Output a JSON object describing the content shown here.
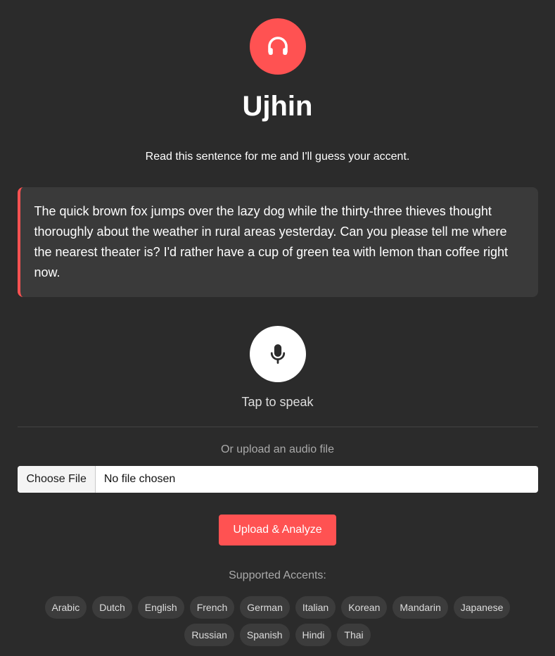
{
  "header": {
    "logo_icon": "headphones-icon",
    "title": "Ujhin",
    "subtitle": "Read this sentence for me and I'll guess your accent."
  },
  "sentence": "The quick brown fox jumps over the lazy dog while the thirty-three thieves thought thoroughly about the weather in rural areas yesterday. Can you please tell me where the nearest theater is? I'd rather have a cup of green tea with lemon than coffee right now.",
  "record": {
    "icon": "microphone-icon",
    "label": "Tap to speak"
  },
  "upload": {
    "label": "Or upload an audio file",
    "choose_file": "Choose File",
    "no_file": "No file chosen",
    "button": "Upload & Analyze"
  },
  "accents": {
    "label": "Supported Accents:",
    "items": [
      "Arabic",
      "Dutch",
      "English",
      "French",
      "German",
      "Italian",
      "Korean",
      "Mandarin",
      "Japanese",
      "Russian",
      "Spanish",
      "Hindi",
      "Thai"
    ]
  },
  "colors": {
    "background": "#2b2b2b",
    "accent": "#ff5252",
    "card": "#3a3a3a",
    "pill": "#3c3c3c"
  }
}
